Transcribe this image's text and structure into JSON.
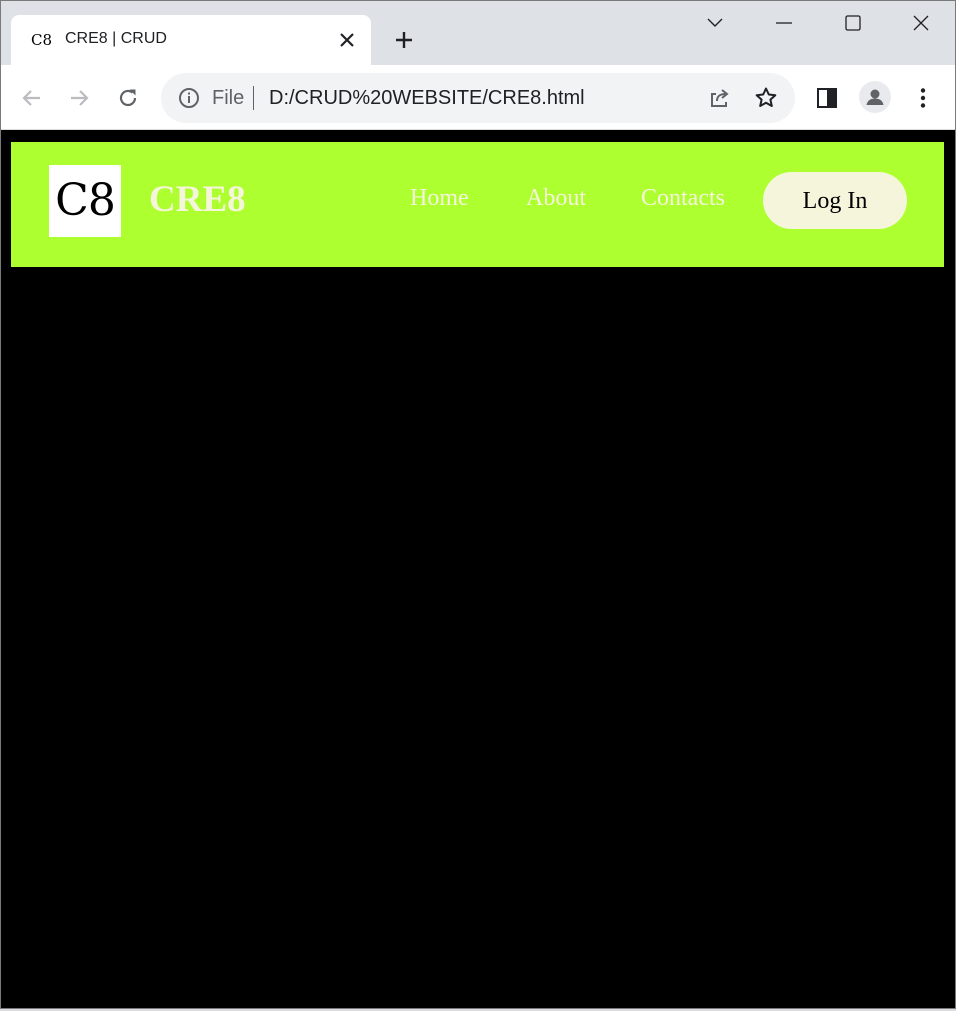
{
  "browser": {
    "tab": {
      "favicon_text": "C8",
      "title": "CRE8 | CRUD"
    },
    "address_bar": {
      "scheme_label": "File",
      "url": "D:/CRUD%20WEBSITE/CRE8.html"
    },
    "icons": {
      "back": "back-arrow-icon",
      "forward": "forward-arrow-icon",
      "reload": "reload-icon",
      "info": "info-icon",
      "share": "share-icon",
      "bookmark": "star-icon",
      "side_panel": "side-panel-icon",
      "profile": "profile-icon",
      "menu": "kebab-menu-icon",
      "tab_search": "chevron-down-icon",
      "minimize": "minimize-icon",
      "maximize": "maximize-icon",
      "close": "close-icon",
      "new_tab": "plus-icon"
    }
  },
  "site": {
    "logo_text": "C8",
    "brand_name": "CRE8",
    "nav": [
      {
        "label": "Home"
      },
      {
        "label": "About"
      },
      {
        "label": "Contacts"
      }
    ],
    "login_label": "Log In",
    "colors": {
      "header_bg": "#adff2f",
      "nav_text": "#f5f5dc",
      "login_bg": "#f5f5dc",
      "page_bg": "#000000"
    }
  }
}
